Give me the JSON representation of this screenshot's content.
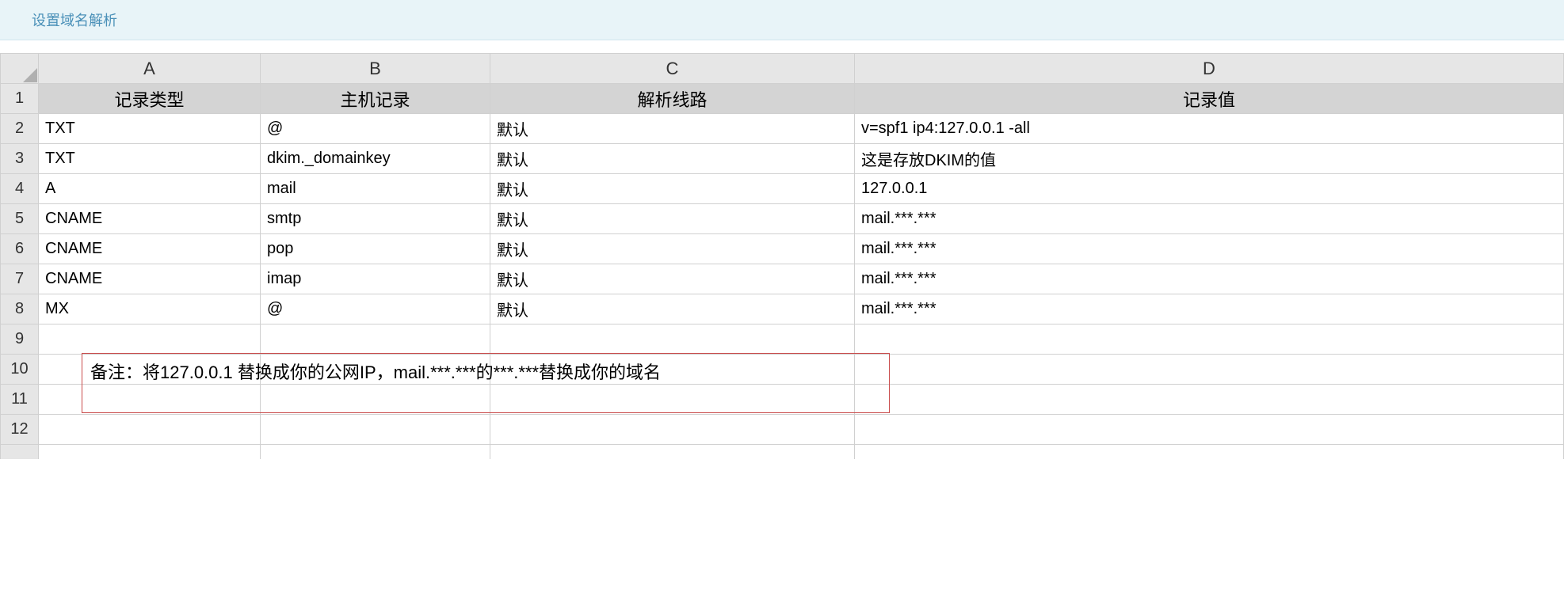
{
  "title": "设置域名解析",
  "columns": [
    "A",
    "B",
    "C",
    "D"
  ],
  "row_numbers": [
    "1",
    "2",
    "3",
    "4",
    "5",
    "6",
    "7",
    "8",
    "9",
    "10",
    "11",
    "12"
  ],
  "headers": {
    "A": "记录类型",
    "B": "主机记录",
    "C": "解析线路",
    "D": "记录值"
  },
  "rows": [
    {
      "A": "TXT",
      "B": "@",
      "C": "默认",
      "D": "v=spf1 ip4:127.0.0.1 -all"
    },
    {
      "A": "TXT",
      "B": "dkim._domainkey",
      "C": "默认",
      "D": "这是存放DKIM的值"
    },
    {
      "A": "A",
      "B": "mail",
      "C": "默认",
      "D": "127.0.0.1"
    },
    {
      "A": "CNAME",
      "B": "smtp",
      "C": "默认",
      "D": "mail.***.***"
    },
    {
      "A": "CNAME",
      "B": "pop",
      "C": "默认",
      "D": "mail.***.***"
    },
    {
      "A": "CNAME",
      "B": "imap",
      "C": "默认",
      "D": "mail.***.***"
    },
    {
      "A": "MX",
      "B": "@",
      "C": "默认",
      "D": "mail.***.***"
    }
  ],
  "note": "备注：将127.0.0.1 替换成你的公网IP，mail.***.***的***.***替换成你的域名"
}
